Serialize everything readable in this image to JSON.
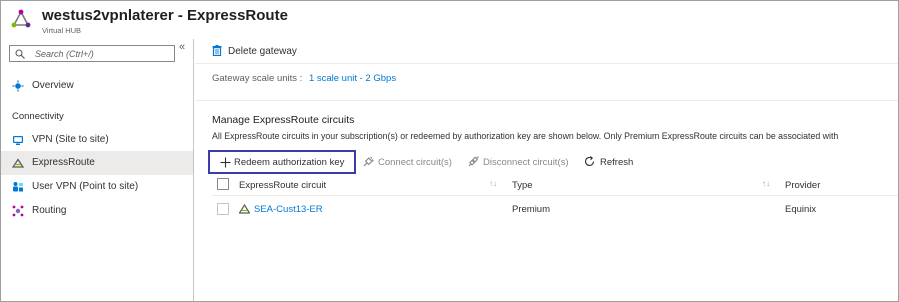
{
  "header": {
    "title": "westus2vpnlaterer - ExpressRoute",
    "subtitle": "Virtual HUB"
  },
  "sidebar": {
    "search_placeholder": "Search (Ctrl+/)",
    "collapse_glyph": "«",
    "overview": "Overview",
    "section": "Connectivity",
    "items": [
      {
        "label": "VPN (Site to site)",
        "icon": "vpn-site-icon"
      },
      {
        "label": "ExpressRoute",
        "icon": "expressroute-icon",
        "active": true
      },
      {
        "label": "User VPN (Point to site)",
        "icon": "user-vpn-icon"
      },
      {
        "label": "Routing",
        "icon": "routing-icon"
      }
    ]
  },
  "main": {
    "delete_gateway": "Delete gateway",
    "scale_label": "Gateway scale units :",
    "scale_value": "1 scale unit - 2 Gbps",
    "section_title": "Manage ExpressRoute circuits",
    "section_desc": "All ExpressRoute circuits in your subscription(s) or redeemed by authorization key are shown below. Only Premium ExpressRoute circuits can be associated with",
    "commands": {
      "redeem": "Redeem authorization key",
      "connect": "Connect circuit(s)",
      "disconnect": "Disconnect circuit(s)",
      "refresh": "Refresh"
    },
    "table": {
      "headers": [
        "ExpressRoute circuit",
        "Type",
        "Provider"
      ],
      "rows": [
        {
          "circuit": "SEA-Cust13-ER",
          "type": "Premium",
          "provider": "Equinix"
        }
      ]
    }
  },
  "colors": {
    "accent": "#0078d4",
    "highlight_border": "#3b3bad",
    "active_nav": "#edebe9"
  }
}
